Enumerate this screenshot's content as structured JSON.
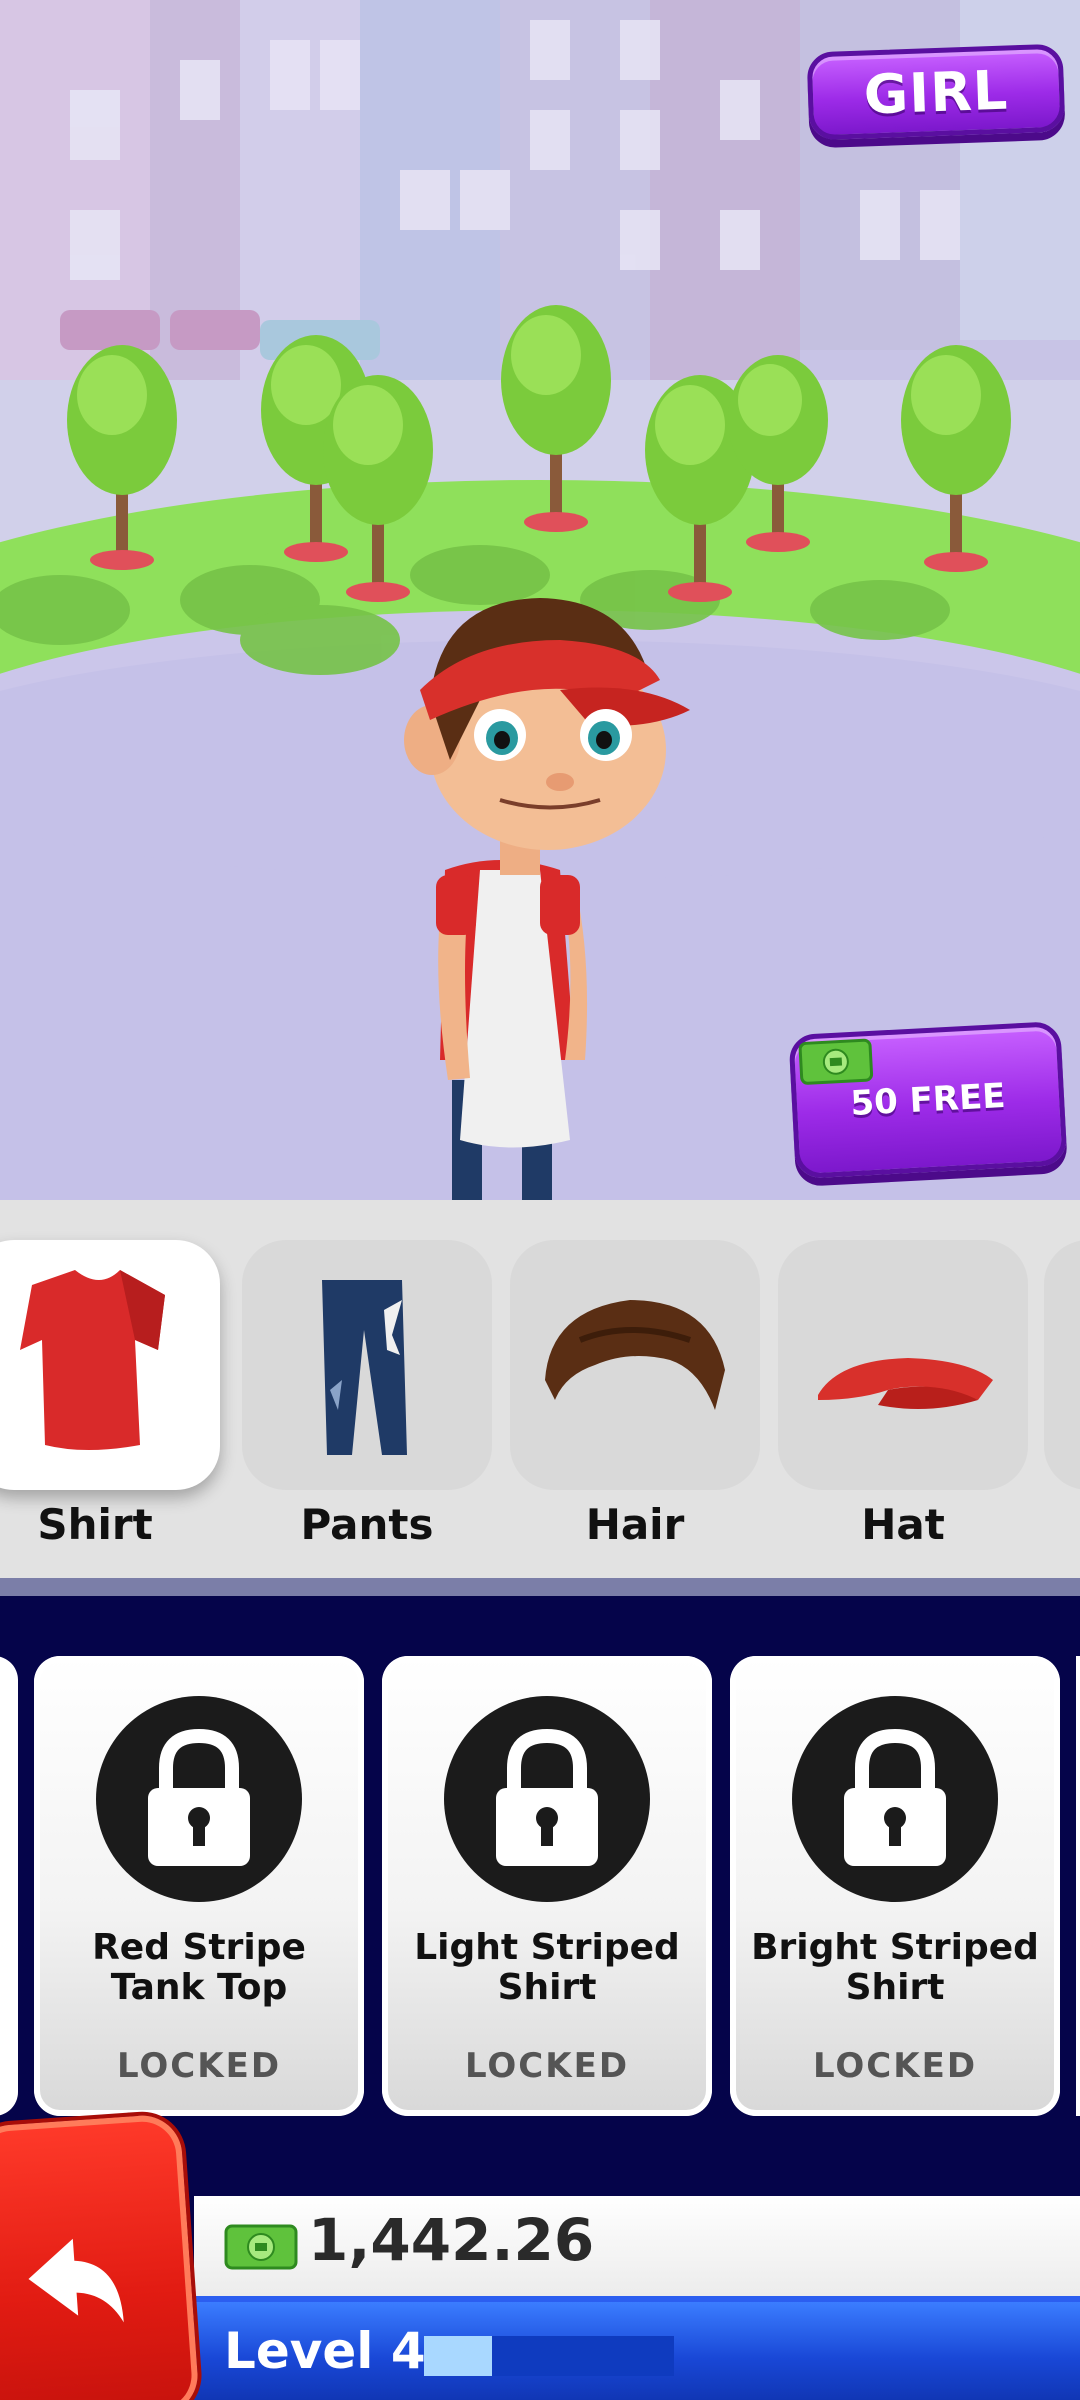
{
  "top_bar": {
    "gender_button_label": "GIRL"
  },
  "promo": {
    "free_cash_label": "50 FREE",
    "icon": "cash-icon"
  },
  "categories": [
    {
      "label": "Shirt",
      "icon": "shirt-icon",
      "selected": true
    },
    {
      "label": "Pants",
      "icon": "pants-icon",
      "selected": false
    },
    {
      "label": "Hair",
      "icon": "hair-icon",
      "selected": false
    },
    {
      "label": "Hat",
      "icon": "hat-icon",
      "selected": false
    }
  ],
  "items": [
    {
      "name_line1": "Red Stripe",
      "name_line2": "Tank Top",
      "status": "LOCKED",
      "icon": "lock-icon"
    },
    {
      "name_line1": "Light Striped",
      "name_line2": "Shirt",
      "status": "LOCKED",
      "icon": "lock-icon"
    },
    {
      "name_line1": "Bright Striped",
      "name_line2": "Shirt",
      "status": "LOCKED",
      "icon": "lock-icon"
    }
  ],
  "footer": {
    "back_icon": "back-arrow-icon",
    "money": "1,442.26",
    "level_label": "Level 4",
    "level_progress": 0.27
  },
  "colors": {
    "accent_purple": "#a232ee",
    "back_red": "#e11b12",
    "level_blue": "#1947d6",
    "items_bg": "#05044a"
  }
}
